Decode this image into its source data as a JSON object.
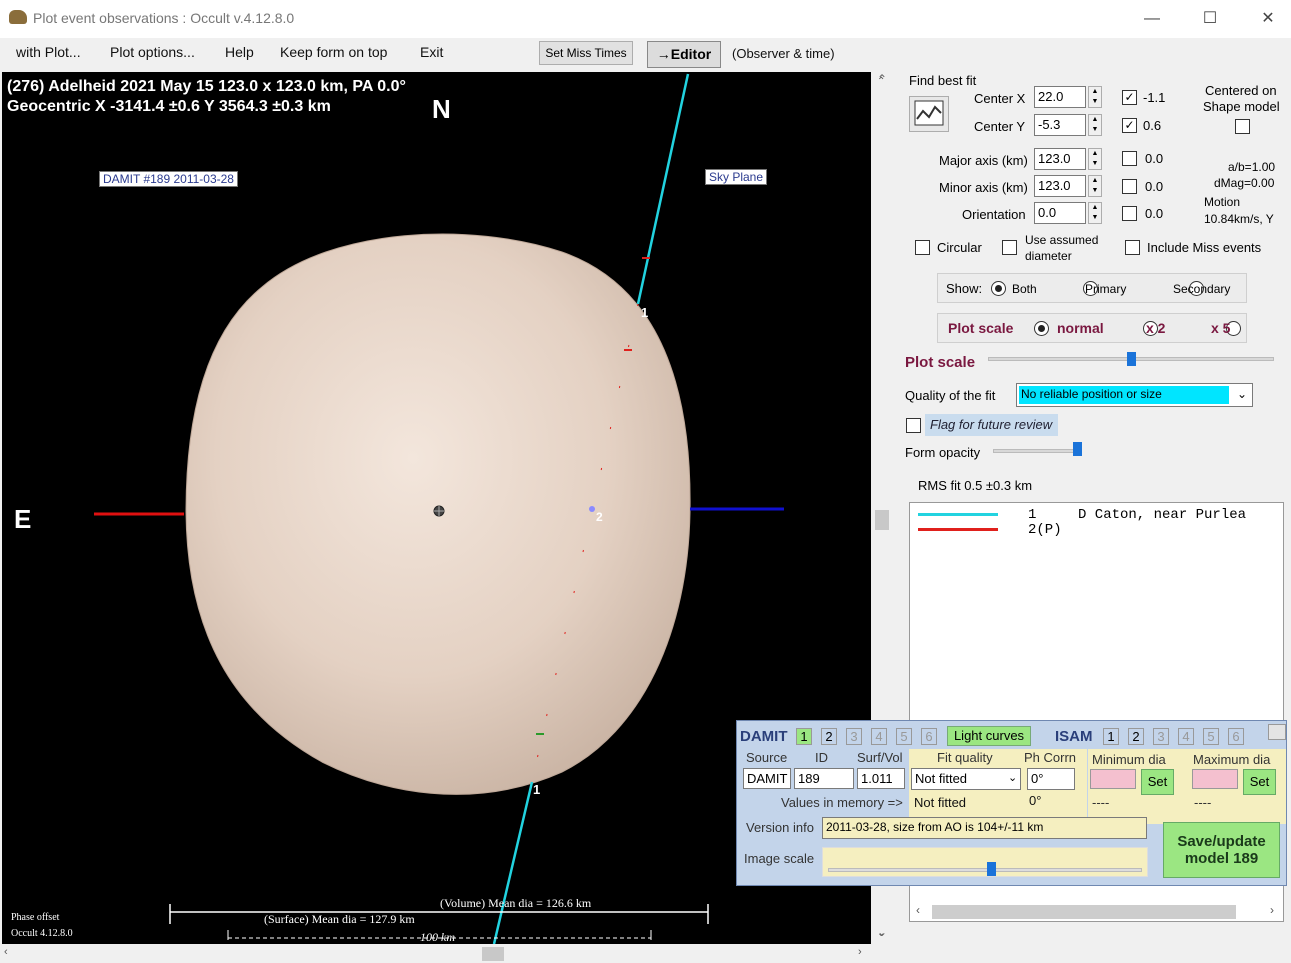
{
  "window": {
    "title": "Plot event observations : Occult v.4.12.8.0",
    "minimize": "—",
    "maximize": "☐",
    "close": "✕"
  },
  "menu": {
    "with_plot": "with Plot...",
    "plot_options": "Plot options...",
    "help": "Help",
    "keep_on_top": "Keep form on top",
    "exit": "Exit",
    "set_miss_times": "Set Miss Times",
    "editor": "→Editor",
    "observer_time": "(Observer & time)"
  },
  "plot": {
    "header1": "(276) Adelheid  2021 May 15   123.0 x 123.0 km, PA 0.0°",
    "header2": "Geocentric  X  -3141.4 ±0.6  Y 3564.3 ±0.3 km",
    "north": "N",
    "east": "E",
    "damit_label": "DAMIT #189 2011-03-28",
    "sky_plane": "Sky Plane",
    "chord1_label_top": "1",
    "chord1_label_bottom": "1",
    "chord2_label": "2",
    "volume_dia": "(Volume) Mean dia = 126.6 km",
    "surface_dia": "(Surface) Mean dia = 127.9 km",
    "scale_bar": "100 km",
    "phase_offset": "Phase offset",
    "version": "Occult 4.12.8.0",
    "colors": {
      "chord1": "#22d3e0",
      "chord2": "#e0201c",
      "west_axis": "#1010d0",
      "east_axis": "#e01010",
      "shape": "#ead9cc"
    }
  },
  "panel": {
    "find_best_fit": "Find best fit",
    "center_x_label": "Center X",
    "center_x": "22.0",
    "center_x_chk": "-1.1",
    "center_y_label": "Center Y",
    "center_y": "-5.3",
    "center_y_chk": "0.6",
    "major_label": "Major axis (km)",
    "major": "123.0",
    "major_chk": "0.0",
    "minor_label": "Minor axis (km)",
    "minor": "123.0",
    "minor_chk": "0.0",
    "orient_label": "Orientation",
    "orient": "0.0",
    "orient_chk": "0.0",
    "centered_on": "Centered on",
    "shape_model": "Shape model",
    "ab": "a/b=1.00",
    "dmag": "dMag=0.00",
    "motion": "Motion",
    "motion_val": "10.84km/s, Y",
    "circular": "Circular",
    "use_assumed": "Use assumed",
    "diameter": "diameter",
    "include_miss": "Include Miss events",
    "show": "Show:",
    "both": "Both",
    "primary": "Primary",
    "secondary": "Secondary",
    "plot_scale": "Plot scale",
    "normal": "normal",
    "x2": "x 2",
    "x5": "x 5",
    "plot_scale2": "Plot scale",
    "quality_label": "Quality of the fit",
    "quality_value": "No reliable position or size",
    "flag_review": "Flag for future review",
    "form_opacity": "Form opacity",
    "rms": "RMS fit 0.5 ±0.3 km",
    "legend": [
      {
        "num": "1",
        "name": "D Caton, near Purlea",
        "color": "#22d3e0"
      },
      {
        "num": "2(P)",
        "name": "",
        "color": "#e0201c"
      }
    ]
  },
  "damit": {
    "damit": "DAMIT",
    "isam": "ISAM",
    "nums": [
      "1",
      "2",
      "3",
      "4",
      "5",
      "6"
    ],
    "light_curves": "Light curves",
    "source_h": "Source",
    "id_h": "ID",
    "surf_h": "Surf/Vol",
    "fitq_h": "Fit quality",
    "phcorr_h": "Ph Corrn",
    "mindia_h": "Minimum dia",
    "maxdia_h": "Maximum dia",
    "source": "DAMIT",
    "id": "189",
    "surf": "1.011",
    "fitq": "Not fitted",
    "phcorr": "0°",
    "set": "Set",
    "set2": "Set",
    "values_in_memory": "Values in memory =>",
    "mem_fitq": "Not fitted",
    "mem_phcorr": "0°",
    "mem_min": "----",
    "mem_max": "----",
    "version_info_label": "Version info",
    "version_info": "2011-03-28, size from AO is 104+/-11 km",
    "image_scale": "Image scale",
    "save": "Save/update",
    "model": "model 189"
  }
}
